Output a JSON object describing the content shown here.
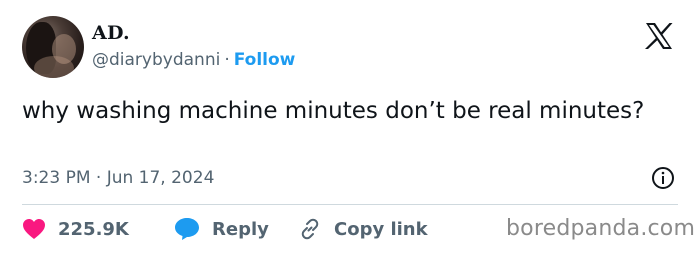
{
  "author": {
    "name": "AD.",
    "handle": "@diarybydanni",
    "separator": "·",
    "follow_label": "Follow"
  },
  "tweet": {
    "text": "why washing machine minutes don’t be real minutes?",
    "timestamp": "3:23 PM · Jun 17, 2024"
  },
  "actions": {
    "likes_count": "225.9K",
    "reply_label": "Reply",
    "copy_link_label": "Copy link"
  },
  "watermark": "boredpanda.com",
  "icons": {
    "platform": "x-logo-icon",
    "info": "info-icon",
    "like": "heart-icon",
    "reply": "speech-bubble-icon",
    "copy": "link-icon"
  },
  "colors": {
    "accent": "#1d9bf0",
    "like": "#f91880",
    "text": "#0f1419",
    "secondary": "#536471"
  }
}
